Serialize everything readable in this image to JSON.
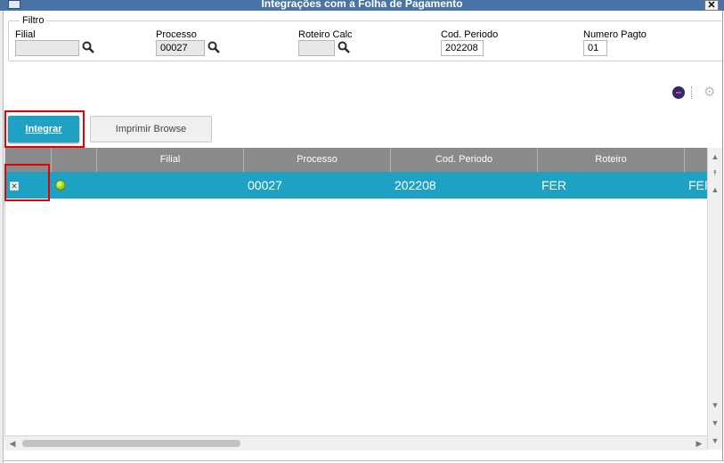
{
  "window": {
    "title": "Integrações com a Folha de Pagamento",
    "close_glyph": "✕"
  },
  "filter": {
    "legend": "Filtro",
    "fields": [
      {
        "label": "Filial",
        "value": ""
      },
      {
        "label": "Processo",
        "value": "00027"
      },
      {
        "label": "Roteiro Calc",
        "value": ""
      },
      {
        "label": "Cod. Periodo",
        "value": "202208"
      },
      {
        "label": "Numero Pagto",
        "value": "01"
      }
    ]
  },
  "toolbar": {
    "integrar_label": "Integrar",
    "imprimir_label": "Imprimir Browse",
    "settings_icon": "gear-icon"
  },
  "grid": {
    "columns": [
      "",
      "",
      "Filial",
      "Processo",
      "Cod. Periodo",
      "Roteiro",
      ""
    ],
    "rows": [
      {
        "checked": true,
        "status": "green",
        "filial": "",
        "processo": "00027",
        "cod_periodo": "202208",
        "roteiro": "FER",
        "extra": "FER"
      }
    ]
  },
  "colors": {
    "accent": "#1fa1c4",
    "header": "#8a8a8a",
    "highlight": "#e20000"
  }
}
